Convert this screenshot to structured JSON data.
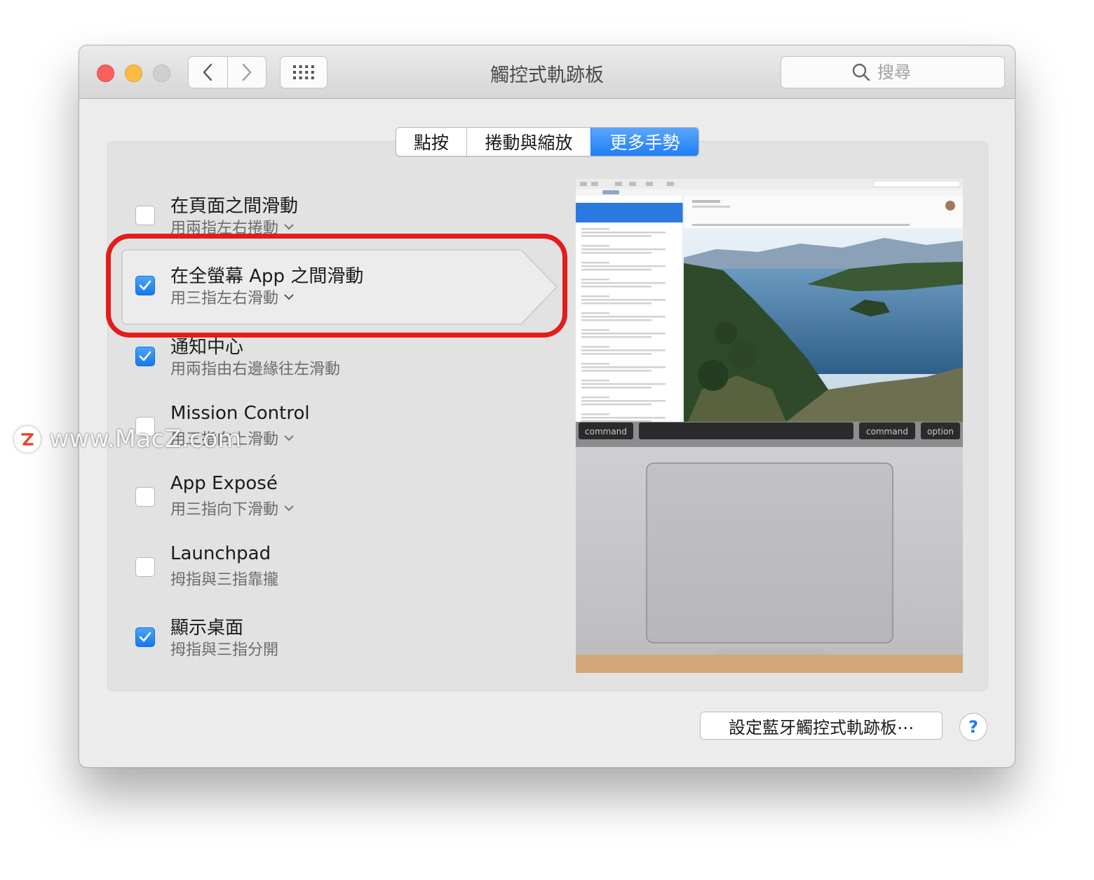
{
  "window": {
    "title": "觸控式軌跡板",
    "search_placeholder": "搜尋"
  },
  "tabs": [
    {
      "label": "點按",
      "active": false
    },
    {
      "label": "捲動與縮放",
      "active": false
    },
    {
      "label": "更多手勢",
      "active": true
    }
  ],
  "options": [
    {
      "title": "在頁面之間滑動",
      "subtitle": "用兩指左右捲動",
      "checked": false,
      "has_menu": true
    },
    {
      "title": "在全螢幕 App 之間滑動",
      "subtitle": "用三指左右滑動",
      "checked": true,
      "has_menu": true
    },
    {
      "title": "通知中心",
      "subtitle": "用兩指由右邊緣往左滑動",
      "checked": true,
      "has_menu": false
    },
    {
      "title": "Mission Control",
      "subtitle": "用三指向上滑動",
      "checked": false,
      "has_menu": true
    },
    {
      "title": "App Exposé",
      "subtitle": "用三指向下滑動",
      "checked": false,
      "has_menu": true
    },
    {
      "title": "Launchpad",
      "subtitle": "拇指與三指靠攏",
      "checked": false,
      "has_menu": false
    },
    {
      "title": "顯示桌面",
      "subtitle": "拇指與三指分開",
      "checked": true,
      "has_menu": false
    }
  ],
  "preview": {
    "keys": [
      "command",
      "command",
      "option"
    ]
  },
  "buttons": {
    "bluetooth": "設定藍牙觸控式軌跡板⋯",
    "help": "?"
  },
  "watermark": {
    "text": "www.MacZ.com",
    "logo_letter": "Z"
  },
  "colors": {
    "accent": "#1f7ff5",
    "highlight_ring": "#e31c1c",
    "close": "#fc605b",
    "minimize": "#fdbc40"
  }
}
